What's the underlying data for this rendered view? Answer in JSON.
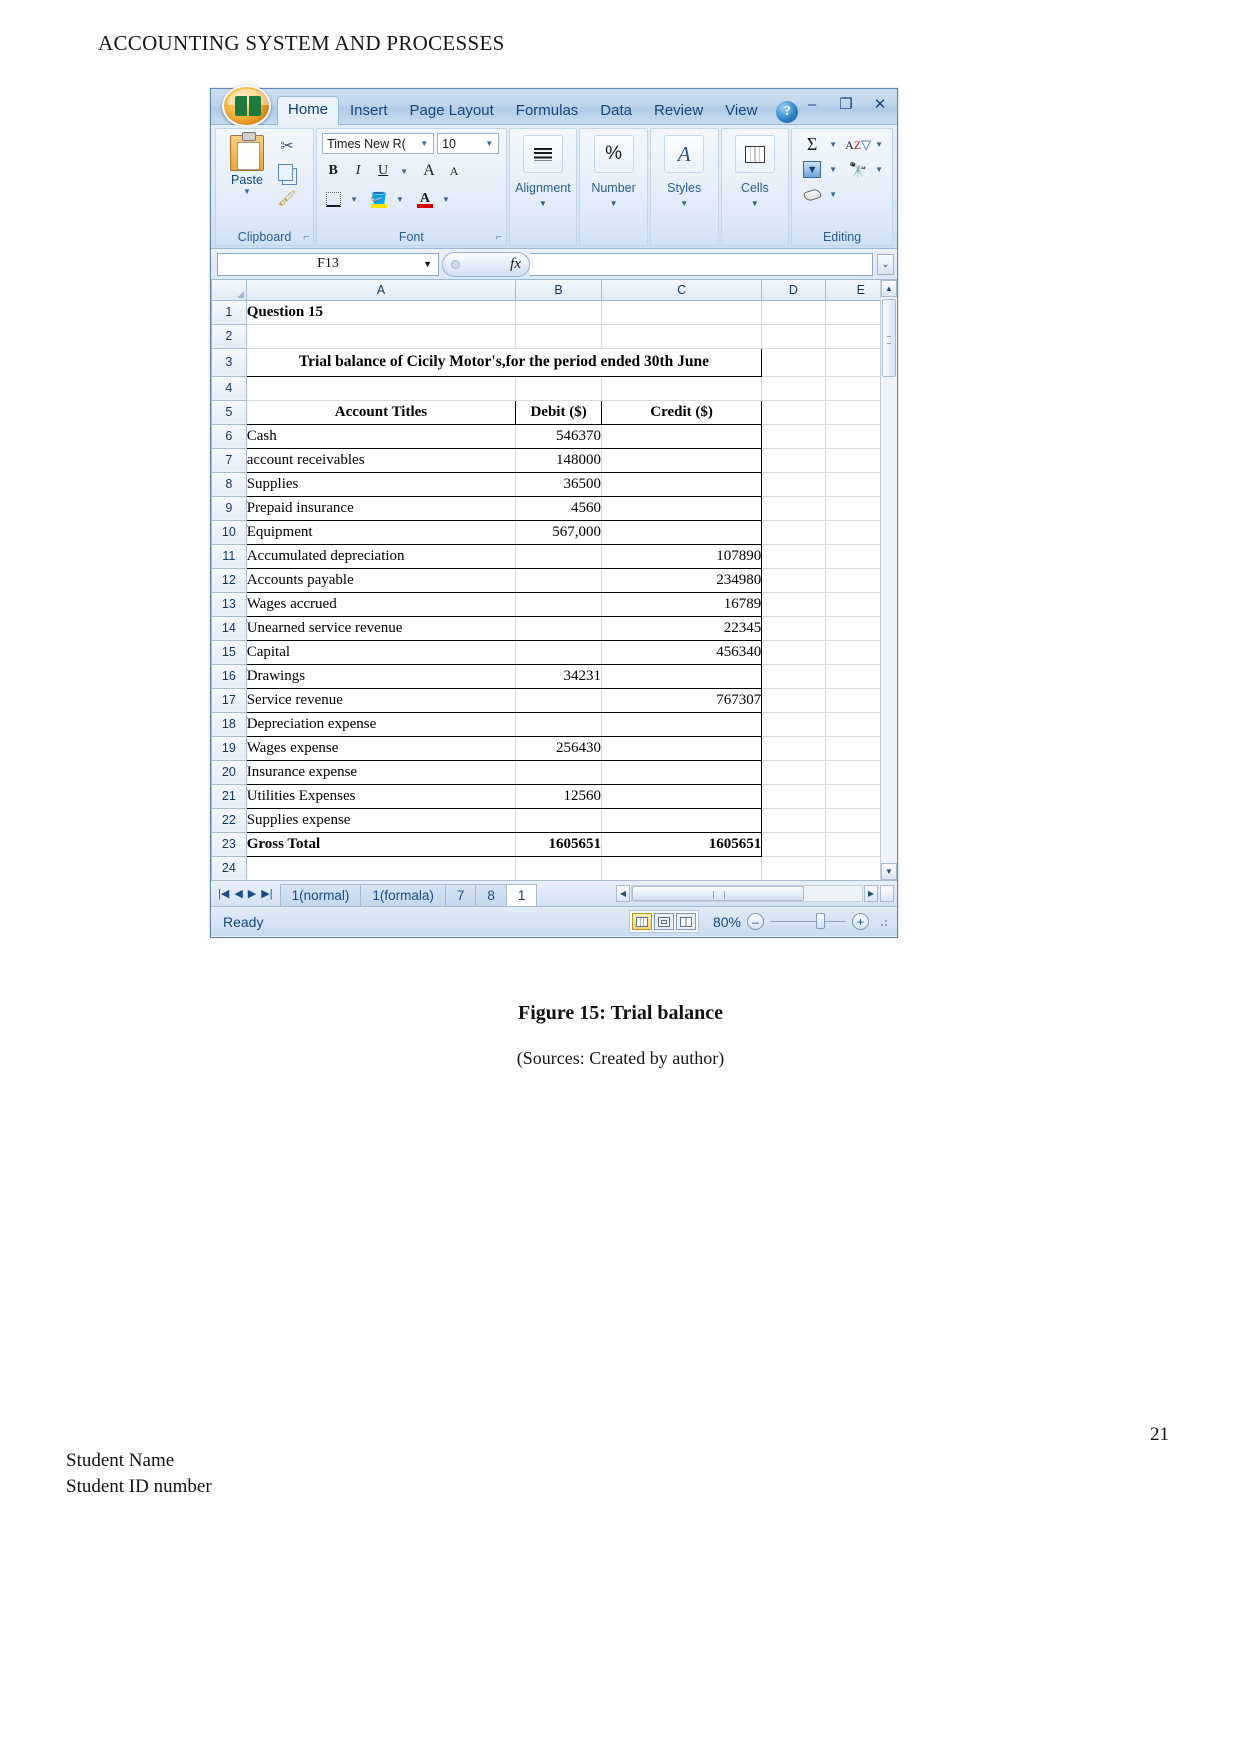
{
  "document": {
    "header": "ACCOUNTING SYSTEM AND PROCESSES",
    "figure_caption": "Figure 15: Trial balance",
    "figure_source": "(Sources: Created by author)",
    "page_number": "21",
    "footer_line1": "Student Name",
    "footer_line2": "Student ID number"
  },
  "excel": {
    "ribbon_tabs": [
      {
        "label": "Home",
        "active": true
      },
      {
        "label": "Insert",
        "active": false
      },
      {
        "label": "Page Layout",
        "active": false
      },
      {
        "label": "Formulas",
        "active": false
      },
      {
        "label": "Data",
        "active": false
      },
      {
        "label": "Review",
        "active": false
      },
      {
        "label": "View",
        "active": false
      }
    ],
    "help_label": "?",
    "window_buttons": {
      "minimize": "–",
      "restore": "❐",
      "close": "✕"
    },
    "groups": {
      "clipboard": {
        "label": "Clipboard",
        "paste": "Paste",
        "launcher": "⌐"
      },
      "font": {
        "label": "Font",
        "font_name": "Times New R(",
        "font_size": "10",
        "bold": "B",
        "italic": "I",
        "underline": "U",
        "grow": "A",
        "shrink": "A",
        "launcher": "⌐"
      },
      "alignment": {
        "label": "Alignment",
        "icon": "align-center-icon"
      },
      "number": {
        "label": "Number",
        "icon": "percent-icon",
        "glyph": "%"
      },
      "styles": {
        "label": "Styles",
        "icon": "styles-icon",
        "glyph": "A"
      },
      "cells": {
        "label": "Cells",
        "icon": "cells-icon"
      },
      "editing": {
        "label": "Editing",
        "autosum": "Σ",
        "sort_filter": "A/Z",
        "fill": "fill-icon",
        "find": "find-icon",
        "clear": "clear-icon"
      }
    },
    "formula_bar": {
      "name_box": "F13",
      "fx_label": "fx",
      "formula_value": ""
    },
    "columns": [
      "A",
      "B",
      "C",
      "D",
      "E"
    ],
    "rows": [
      {
        "n": "1",
        "a": "Question 15",
        "b": "",
        "c": ""
      },
      {
        "n": "2",
        "a": "",
        "b": "",
        "c": ""
      },
      {
        "n": "3",
        "a": "Trial balance of Cicily Motor's,for the period ended 30th June",
        "b": "",
        "c": ""
      },
      {
        "n": "4",
        "a": "",
        "b": "",
        "c": ""
      },
      {
        "n": "5",
        "a": "Account Titles",
        "b": "Debit ($)",
        "c": "Credit ($)"
      },
      {
        "n": "6",
        "a": "Cash",
        "b": "546370",
        "c": ""
      },
      {
        "n": "7",
        "a": "account receivables",
        "b": "148000",
        "c": ""
      },
      {
        "n": "8",
        "a": "Supplies",
        "b": "36500",
        "c": ""
      },
      {
        "n": "9",
        "a": "Prepaid insurance",
        "b": "4560",
        "c": ""
      },
      {
        "n": "10",
        "a": "Equipment",
        "b": "567,000",
        "c": ""
      },
      {
        "n": "11",
        "a": "Accumulated depreciation",
        "b": "",
        "c": "107890"
      },
      {
        "n": "12",
        "a": "Accounts payable",
        "b": "",
        "c": "234980"
      },
      {
        "n": "13",
        "a": "Wages accrued",
        "b": "",
        "c": "16789"
      },
      {
        "n": "14",
        "a": "Unearned service revenue",
        "b": "",
        "c": "22345"
      },
      {
        "n": "15",
        "a": "Capital",
        "b": "",
        "c": "456340"
      },
      {
        "n": "16",
        "a": "Drawings",
        "b": "34231",
        "c": ""
      },
      {
        "n": "17",
        "a": "Service revenue",
        "b": "",
        "c": "767307"
      },
      {
        "n": "18",
        "a": "Depreciation expense",
        "b": "",
        "c": ""
      },
      {
        "n": "19",
        "a": "Wages expense",
        "b": "256430",
        "c": ""
      },
      {
        "n": "20",
        "a": "Insurance expense",
        "b": "",
        "c": ""
      },
      {
        "n": "21",
        "a": "Utilities Expenses",
        "b": "12560",
        "c": ""
      },
      {
        "n": "22",
        "a": "Supplies expense",
        "b": "",
        "c": ""
      },
      {
        "n": "23",
        "a": "Gross Total",
        "b": "1605651",
        "c": "1605651"
      },
      {
        "n": "24",
        "a": "",
        "b": "",
        "c": ""
      }
    ],
    "sheet_tabs": [
      {
        "label": "1(normal)",
        "active": false
      },
      {
        "label": "1(formala)",
        "active": false
      },
      {
        "label": "7",
        "active": false
      },
      {
        "label": "8",
        "active": false
      },
      {
        "label": "1",
        "active": true
      }
    ],
    "status_bar": {
      "mode": "Ready",
      "zoom": "80%",
      "zoom_out": "–",
      "zoom_in": "+",
      "views": [
        "normal-view-icon",
        "page-layout-icon",
        "page-break-icon"
      ]
    }
  }
}
